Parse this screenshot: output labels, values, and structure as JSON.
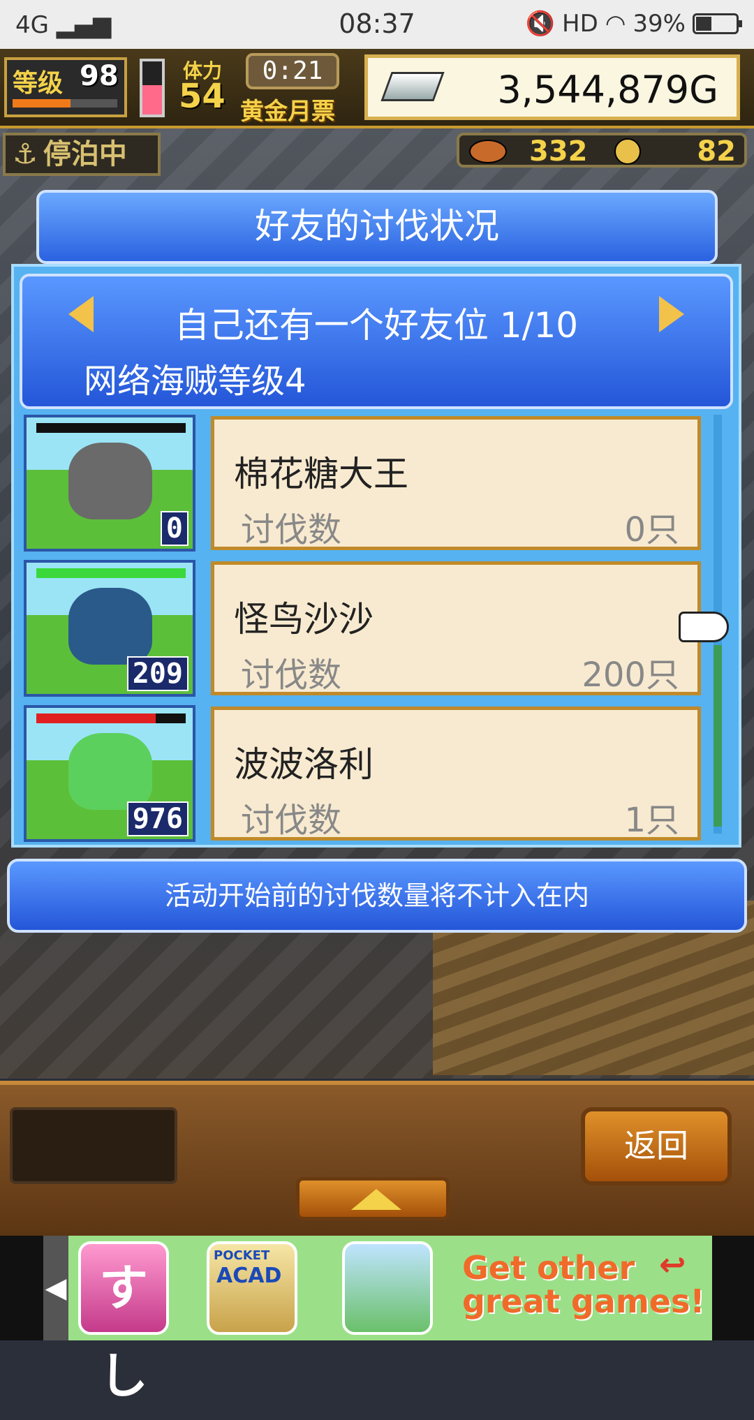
{
  "status_bar": {
    "network": "4G",
    "time": "08:37",
    "hd": "HD",
    "battery": "39%",
    "battery_level": 0.39
  },
  "hud": {
    "level_label": "等级",
    "level_value": "98",
    "level_progress": 0.55,
    "stamina_level": 0.55,
    "stamina_label": "体力",
    "stamina_value": "54",
    "timer": "0:21",
    "gold_pass": "黄金月票",
    "gold_value": "3,544,879G",
    "docked": "停泊中",
    "food_value": "332",
    "coin_value": "82"
  },
  "panel": {
    "title": "好友的讨伐状况",
    "slot_text": "自己还有一个好友位 1/10",
    "pirate_level": "网络海贼等级4"
  },
  "rows": [
    {
      "name": "棉花糖大王",
      "kill_label": "讨伐数",
      "kill_value": "0只",
      "thumb_count": "0",
      "hp": 1.0,
      "hp_color": "#111111",
      "monster_color": "#6a6a6a"
    },
    {
      "name": "怪鸟沙沙",
      "kill_label": "讨伐数",
      "kill_value": "200只",
      "thumb_count": "209",
      "hp": 1.0,
      "hp_color": "#3ad83a",
      "monster_color": "#2a5a8a"
    },
    {
      "name": "波波洛利",
      "kill_label": "讨伐数",
      "kill_value": "1只",
      "thumb_count": "976",
      "hp": 0.8,
      "hp_color": "#e02020",
      "monster_color": "#5cd05c"
    }
  ],
  "notice": "活动开始前的讨伐数量将不计入在内",
  "bottom": {
    "back_label": "返回"
  },
  "ad": {
    "app1": "すし",
    "app2_top": "POCKET",
    "app2_main": "ACAD",
    "text_line1": "Get other",
    "text_line2": "great games!"
  }
}
